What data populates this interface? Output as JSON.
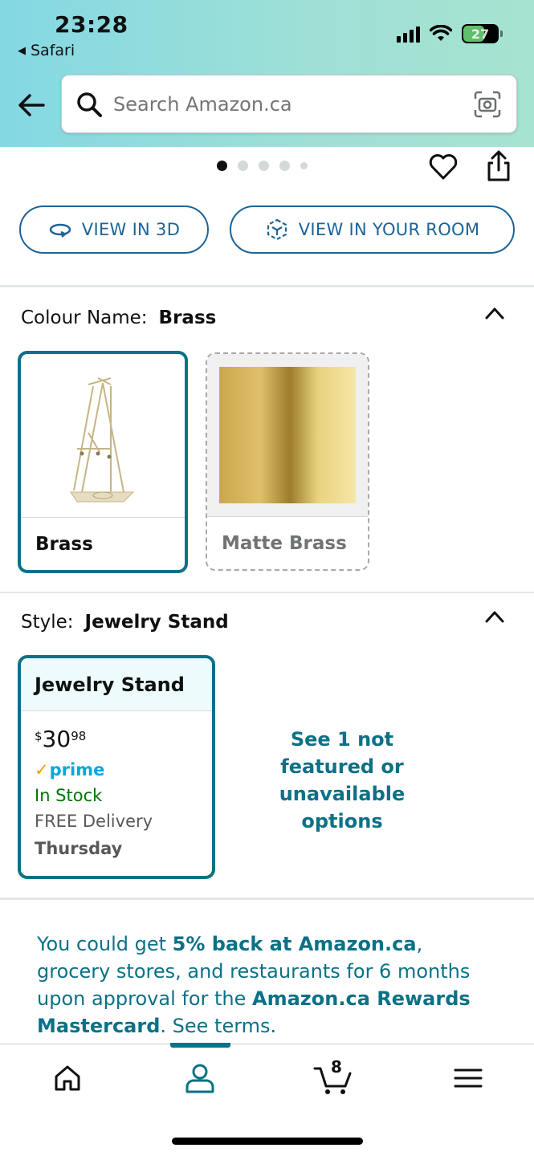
{
  "status_bar": {
    "time": "23:28",
    "back_app": "Safari",
    "battery": "27"
  },
  "search": {
    "placeholder": "Search Amazon.ca"
  },
  "image_carousel": {
    "dot_count": 5,
    "active_index": 0
  },
  "buttons": {
    "view_3d": "VIEW IN 3D",
    "view_room": "VIEW IN YOUR ROOM"
  },
  "colour": {
    "label": "Colour Name:",
    "selected": "Brass",
    "options": [
      {
        "name": "Brass",
        "selected": true
      },
      {
        "name": "Matte Brass",
        "selected": false
      }
    ]
  },
  "style": {
    "label": "Style:",
    "selected": "Jewelry Stand",
    "card": {
      "title": "Jewelry Stand",
      "price_symbol": "$",
      "price_whole": "30",
      "price_cents": "98",
      "prime": "prime",
      "availability": "In Stock",
      "delivery": "FREE Delivery",
      "delivery_day": "Thursday"
    },
    "more_options": "See 1 not featured or unavailable options"
  },
  "promo": {
    "p1": "You could get ",
    "b1": "5% back at Amazon.ca",
    "p2": ", grocery stores, and restaurants for 6 months upon approval for the ",
    "b2": "Amazon.ca Rewards Mastercard",
    "p3": ". See terms."
  },
  "bottom_nav": {
    "cart_count": "8",
    "active": "account"
  },
  "colors": {
    "accent_teal": "#0b7186",
    "link_blue": "#1c6495",
    "in_stock_green": "#007600",
    "prime_blue": "#00a8e1"
  }
}
